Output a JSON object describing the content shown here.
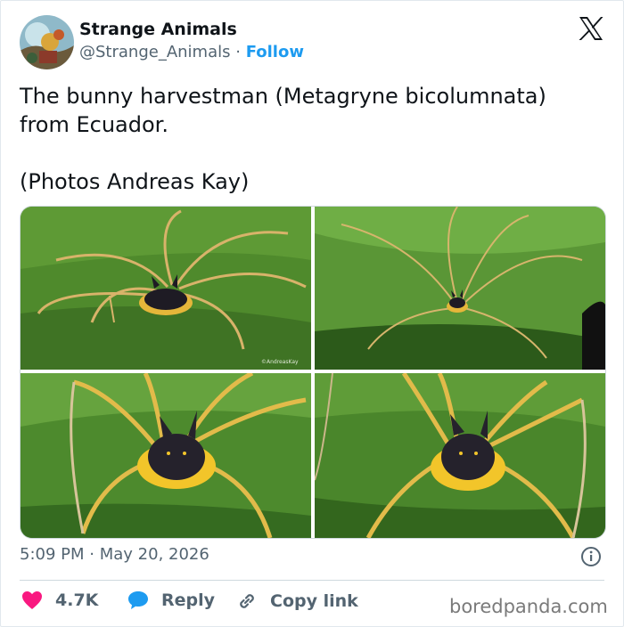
{
  "author": {
    "display_name": "Strange Animals",
    "handle": "@Strange_Animals",
    "separator": "·",
    "follow_label": "Follow"
  },
  "tweet": {
    "line1": "The bunny harvestman (Metagryne bicolumnata)",
    "line2": "from Ecuador.",
    "line3": "(Photos Andreas Kay)"
  },
  "photos": [
    {
      "id": "photo-1",
      "credit": "©AndreasKay"
    },
    {
      "id": "photo-2",
      "credit": ""
    },
    {
      "id": "photo-3",
      "credit": ""
    },
    {
      "id": "photo-4",
      "credit": ""
    }
  ],
  "meta": {
    "time": "5:09 PM",
    "separator": "·",
    "date": "May 20, 2026"
  },
  "actions": {
    "like_count": "4.7K",
    "reply_label": "Reply",
    "copy_label": "Copy link"
  },
  "watermark": "boredpanda.com",
  "colors": {
    "link_blue": "#1d9bf0",
    "heart_red": "#f91880",
    "text_dark": "#0f1419",
    "text_gray": "#536471",
    "leaf_green": "#4c8a2e",
    "spider_yellow": "#f0c419"
  },
  "icons": {
    "platform": "x-logo-icon",
    "info": "info-icon",
    "like": "heart-icon",
    "reply": "speech-bubble-icon",
    "copy": "link-icon"
  }
}
